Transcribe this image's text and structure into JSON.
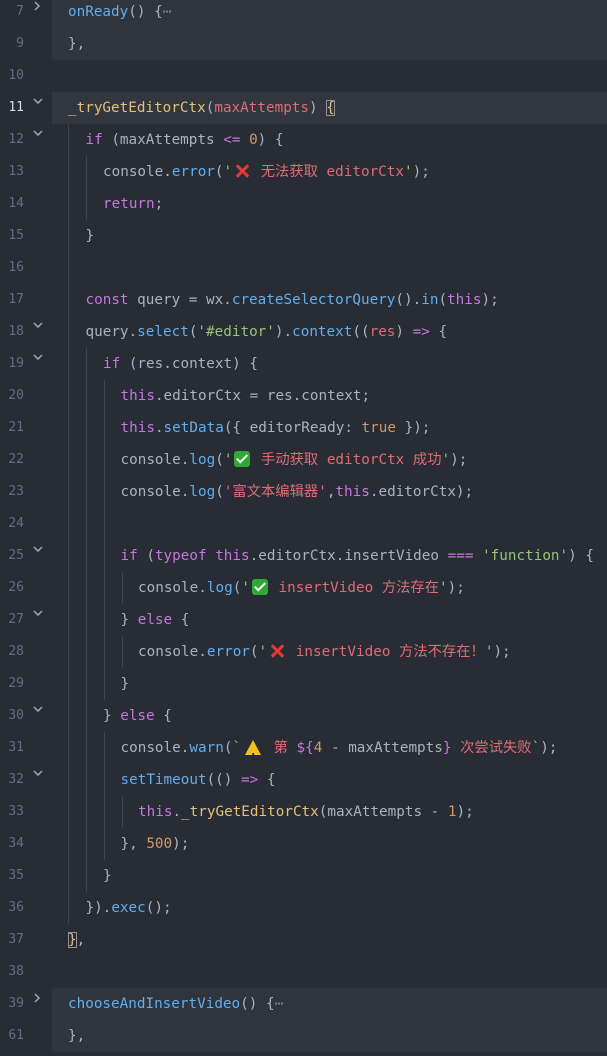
{
  "lines": [
    {
      "num": "7",
      "fold": "closed",
      "bg": "folded",
      "guides": [],
      "indent": 0,
      "tokens": [
        [
          "f",
          "onReady"
        ],
        [
          "d",
          "() {"
        ],
        [
          "ell",
          "⋯"
        ]
      ]
    },
    {
      "num": "9",
      "fold": "",
      "bg": "folded",
      "guides": [],
      "indent": 0,
      "tokens": [
        [
          "d",
          "},"
        ]
      ]
    },
    {
      "num": "10",
      "fold": "",
      "bg": "",
      "guides": [],
      "indent": 0,
      "tokens": []
    },
    {
      "num": "11",
      "fold": "open",
      "bg": "hl",
      "active": true,
      "guides": [],
      "indent": 0,
      "tokens": [
        [
          "fnd",
          "_tryGetEditorCtx"
        ],
        [
          "d",
          "("
        ],
        [
          "p",
          "maxAttempts"
        ],
        [
          "d",
          ") "
        ],
        [
          "bracket",
          "{"
        ]
      ]
    },
    {
      "num": "12",
      "fold": "open",
      "bg": "",
      "guides": [
        68
      ],
      "indent": 1,
      "tokens": [
        [
          "k",
          "if"
        ],
        [
          "d",
          " (maxAttempts "
        ],
        [
          "k",
          "<="
        ],
        [
          "d",
          " "
        ],
        [
          "n",
          "0"
        ],
        [
          "d",
          ") {"
        ]
      ]
    },
    {
      "num": "13",
      "fold": "",
      "bg": "",
      "guides": [
        68,
        86
      ],
      "indent": 2,
      "tokens": [
        [
          "d",
          "console."
        ],
        [
          "f",
          "error"
        ],
        [
          "d",
          "("
        ],
        [
          "s",
          "'"
        ],
        [
          "emoji",
          "cross"
        ],
        [
          "red",
          " 无法获取 editorCtx"
        ],
        [
          "s",
          "'"
        ],
        [
          "d",
          ");"
        ]
      ]
    },
    {
      "num": "14",
      "fold": "",
      "bg": "",
      "guides": [
        68,
        86
      ],
      "indent": 2,
      "tokens": [
        [
          "k",
          "return"
        ],
        [
          "d",
          ";"
        ]
      ]
    },
    {
      "num": "15",
      "fold": "",
      "bg": "",
      "guides": [
        68
      ],
      "indent": 1,
      "tokens": [
        [
          "d",
          "}"
        ]
      ]
    },
    {
      "num": "16",
      "fold": "",
      "bg": "",
      "guides": [
        68
      ],
      "indent": 1,
      "tokens": []
    },
    {
      "num": "17",
      "fold": "",
      "bg": "",
      "guides": [
        68
      ],
      "indent": 1,
      "tokens": [
        [
          "k",
          "const"
        ],
        [
          "d",
          " query = wx."
        ],
        [
          "f",
          "createSelectorQuery"
        ],
        [
          "d",
          "()."
        ],
        [
          "f",
          "in"
        ],
        [
          "d",
          "("
        ],
        [
          "k",
          "this"
        ],
        [
          "d",
          ");"
        ]
      ]
    },
    {
      "num": "18",
      "fold": "open",
      "bg": "",
      "guides": [
        68
      ],
      "indent": 1,
      "tokens": [
        [
          "d",
          "query."
        ],
        [
          "f",
          "select"
        ],
        [
          "d",
          "("
        ],
        [
          "s",
          "'#editor'"
        ],
        [
          "d",
          ")."
        ],
        [
          "f",
          "context"
        ],
        [
          "d",
          "(("
        ],
        [
          "p",
          "res"
        ],
        [
          "d",
          ") "
        ],
        [
          "k",
          "=>"
        ],
        [
          "d",
          " {"
        ]
      ]
    },
    {
      "num": "19",
      "fold": "open",
      "bg": "",
      "guides": [
        68,
        86
      ],
      "indent": 2,
      "tokens": [
        [
          "k",
          "if"
        ],
        [
          "d",
          " (res.context) {"
        ]
      ]
    },
    {
      "num": "20",
      "fold": "",
      "bg": "",
      "guides": [
        68,
        86,
        104
      ],
      "indent": 3,
      "tokens": [
        [
          "k",
          "this"
        ],
        [
          "d",
          ".editorCtx = res.context;"
        ]
      ]
    },
    {
      "num": "21",
      "fold": "",
      "bg": "",
      "guides": [
        68,
        86,
        104
      ],
      "indent": 3,
      "tokens": [
        [
          "k",
          "this"
        ],
        [
          "d",
          "."
        ],
        [
          "f",
          "setData"
        ],
        [
          "d",
          "({ editorReady: "
        ],
        [
          "n",
          "true"
        ],
        [
          "d",
          " });"
        ]
      ]
    },
    {
      "num": "22",
      "fold": "",
      "bg": "",
      "guides": [
        68,
        86,
        104
      ],
      "indent": 3,
      "tokens": [
        [
          "d",
          "console."
        ],
        [
          "f",
          "log"
        ],
        [
          "d",
          "("
        ],
        [
          "s",
          "'"
        ],
        [
          "emoji",
          "check"
        ],
        [
          "red",
          " 手动获取 editorCtx 成功"
        ],
        [
          "s",
          "'"
        ],
        [
          "d",
          ");"
        ]
      ]
    },
    {
      "num": "23",
      "fold": "",
      "bg": "",
      "guides": [
        68,
        86,
        104
      ],
      "indent": 3,
      "tokens": [
        [
          "d",
          "console."
        ],
        [
          "f",
          "log"
        ],
        [
          "d",
          "("
        ],
        [
          "red",
          "'富文本编辑器'"
        ],
        [
          "d",
          ","
        ],
        [
          "k",
          "this"
        ],
        [
          "d",
          ".editorCtx);"
        ]
      ]
    },
    {
      "num": "24",
      "fold": "",
      "bg": "",
      "guides": [
        68,
        86,
        104
      ],
      "indent": 3,
      "tokens": []
    },
    {
      "num": "25",
      "fold": "open",
      "bg": "",
      "guides": [
        68,
        86,
        104
      ],
      "indent": 3,
      "tokens": [
        [
          "k",
          "if"
        ],
        [
          "d",
          " ("
        ],
        [
          "k",
          "typeof"
        ],
        [
          "d",
          " "
        ],
        [
          "k",
          "this"
        ],
        [
          "d",
          ".editorCtx.insertVideo "
        ],
        [
          "k",
          "==="
        ],
        [
          "d",
          " "
        ],
        [
          "s",
          "'function'"
        ],
        [
          "d",
          ") {"
        ]
      ]
    },
    {
      "num": "26",
      "fold": "",
      "bg": "",
      "guides": [
        68,
        86,
        104,
        122
      ],
      "indent": 4,
      "tokens": [
        [
          "d",
          "console."
        ],
        [
          "f",
          "log"
        ],
        [
          "d",
          "("
        ],
        [
          "s",
          "'"
        ],
        [
          "emoji",
          "check"
        ],
        [
          "red",
          " insertVideo 方法存在"
        ],
        [
          "s",
          "'"
        ],
        [
          "d",
          ");"
        ]
      ]
    },
    {
      "num": "27",
      "fold": "open",
      "bg": "",
      "guides": [
        68,
        86,
        104
      ],
      "indent": 3,
      "tokens": [
        [
          "d",
          "} "
        ],
        [
          "k",
          "else"
        ],
        [
          "d",
          " {"
        ]
      ]
    },
    {
      "num": "28",
      "fold": "",
      "bg": "",
      "guides": [
        68,
        86,
        104,
        122
      ],
      "indent": 4,
      "tokens": [
        [
          "d",
          "console."
        ],
        [
          "f",
          "error"
        ],
        [
          "d",
          "("
        ],
        [
          "s",
          "'"
        ],
        [
          "emoji",
          "cross"
        ],
        [
          "red",
          " insertVideo 方法不存在！"
        ],
        [
          "s",
          "'"
        ],
        [
          "d",
          ");"
        ]
      ]
    },
    {
      "num": "29",
      "fold": "",
      "bg": "",
      "guides": [
        68,
        86,
        104
      ],
      "indent": 3,
      "tokens": [
        [
          "d",
          "}"
        ]
      ]
    },
    {
      "num": "30",
      "fold": "open",
      "bg": "",
      "guides": [
        68,
        86
      ],
      "indent": 2,
      "tokens": [
        [
          "d",
          "} "
        ],
        [
          "k",
          "else"
        ],
        [
          "d",
          " {"
        ]
      ]
    },
    {
      "num": "31",
      "fold": "",
      "bg": "",
      "guides": [
        68,
        86,
        104
      ],
      "indent": 3,
      "tokens": [
        [
          "d",
          "console."
        ],
        [
          "f",
          "warn"
        ],
        [
          "d",
          "("
        ],
        [
          "s",
          "`"
        ],
        [
          "emoji",
          "warn"
        ],
        [
          "red",
          " 第 "
        ],
        [
          "k",
          "${"
        ],
        [
          "n",
          "4"
        ],
        [
          "d",
          " - maxAttempts"
        ],
        [
          "k",
          "}"
        ],
        [
          "red",
          " 次尝试失败"
        ],
        [
          "s",
          "`"
        ],
        [
          "d",
          ");"
        ]
      ]
    },
    {
      "num": "32",
      "fold": "open",
      "bg": "",
      "guides": [
        68,
        86,
        104
      ],
      "indent": 3,
      "tokens": [
        [
          "f",
          "setTimeout"
        ],
        [
          "d",
          "(() "
        ],
        [
          "k",
          "=>"
        ],
        [
          "d",
          " {"
        ]
      ]
    },
    {
      "num": "33",
      "fold": "",
      "bg": "",
      "guides": [
        68,
        86,
        104,
        122
      ],
      "indent": 4,
      "tokens": [
        [
          "k",
          "this"
        ],
        [
          "d",
          "."
        ],
        [
          "fnd",
          "_tryGetEditorCtx"
        ],
        [
          "d",
          "(maxAttempts - "
        ],
        [
          "n",
          "1"
        ],
        [
          "d",
          ");"
        ]
      ]
    },
    {
      "num": "34",
      "fold": "",
      "bg": "",
      "guides": [
        68,
        86,
        104
      ],
      "indent": 3,
      "tokens": [
        [
          "d",
          "}, "
        ],
        [
          "n",
          "500"
        ],
        [
          "d",
          ");"
        ]
      ]
    },
    {
      "num": "35",
      "fold": "",
      "bg": "",
      "guides": [
        68,
        86
      ],
      "indent": 2,
      "tokens": [
        [
          "d",
          "}"
        ]
      ]
    },
    {
      "num": "36",
      "fold": "",
      "bg": "",
      "guides": [
        68
      ],
      "indent": 1,
      "tokens": [
        [
          "d",
          "})."
        ],
        [
          "f",
          "exec"
        ],
        [
          "d",
          "();"
        ]
      ]
    },
    {
      "num": "37",
      "fold": "",
      "bg": "",
      "guides": [],
      "indent": 0,
      "tokens": [
        [
          "bracket",
          "}"
        ],
        [
          "d",
          ","
        ]
      ]
    },
    {
      "num": "38",
      "fold": "",
      "bg": "",
      "guides": [],
      "indent": 0,
      "tokens": []
    },
    {
      "num": "39",
      "fold": "closed",
      "bg": "folded",
      "guides": [],
      "indent": 0,
      "tokens": [
        [
          "f",
          "chooseAndInsertVideo"
        ],
        [
          "d",
          "() {"
        ],
        [
          "ell",
          "⋯"
        ]
      ]
    },
    {
      "num": "61",
      "fold": "",
      "bg": "folded",
      "guides": [],
      "indent": 0,
      "tokens": [
        [
          "d",
          "},"
        ]
      ]
    }
  ]
}
